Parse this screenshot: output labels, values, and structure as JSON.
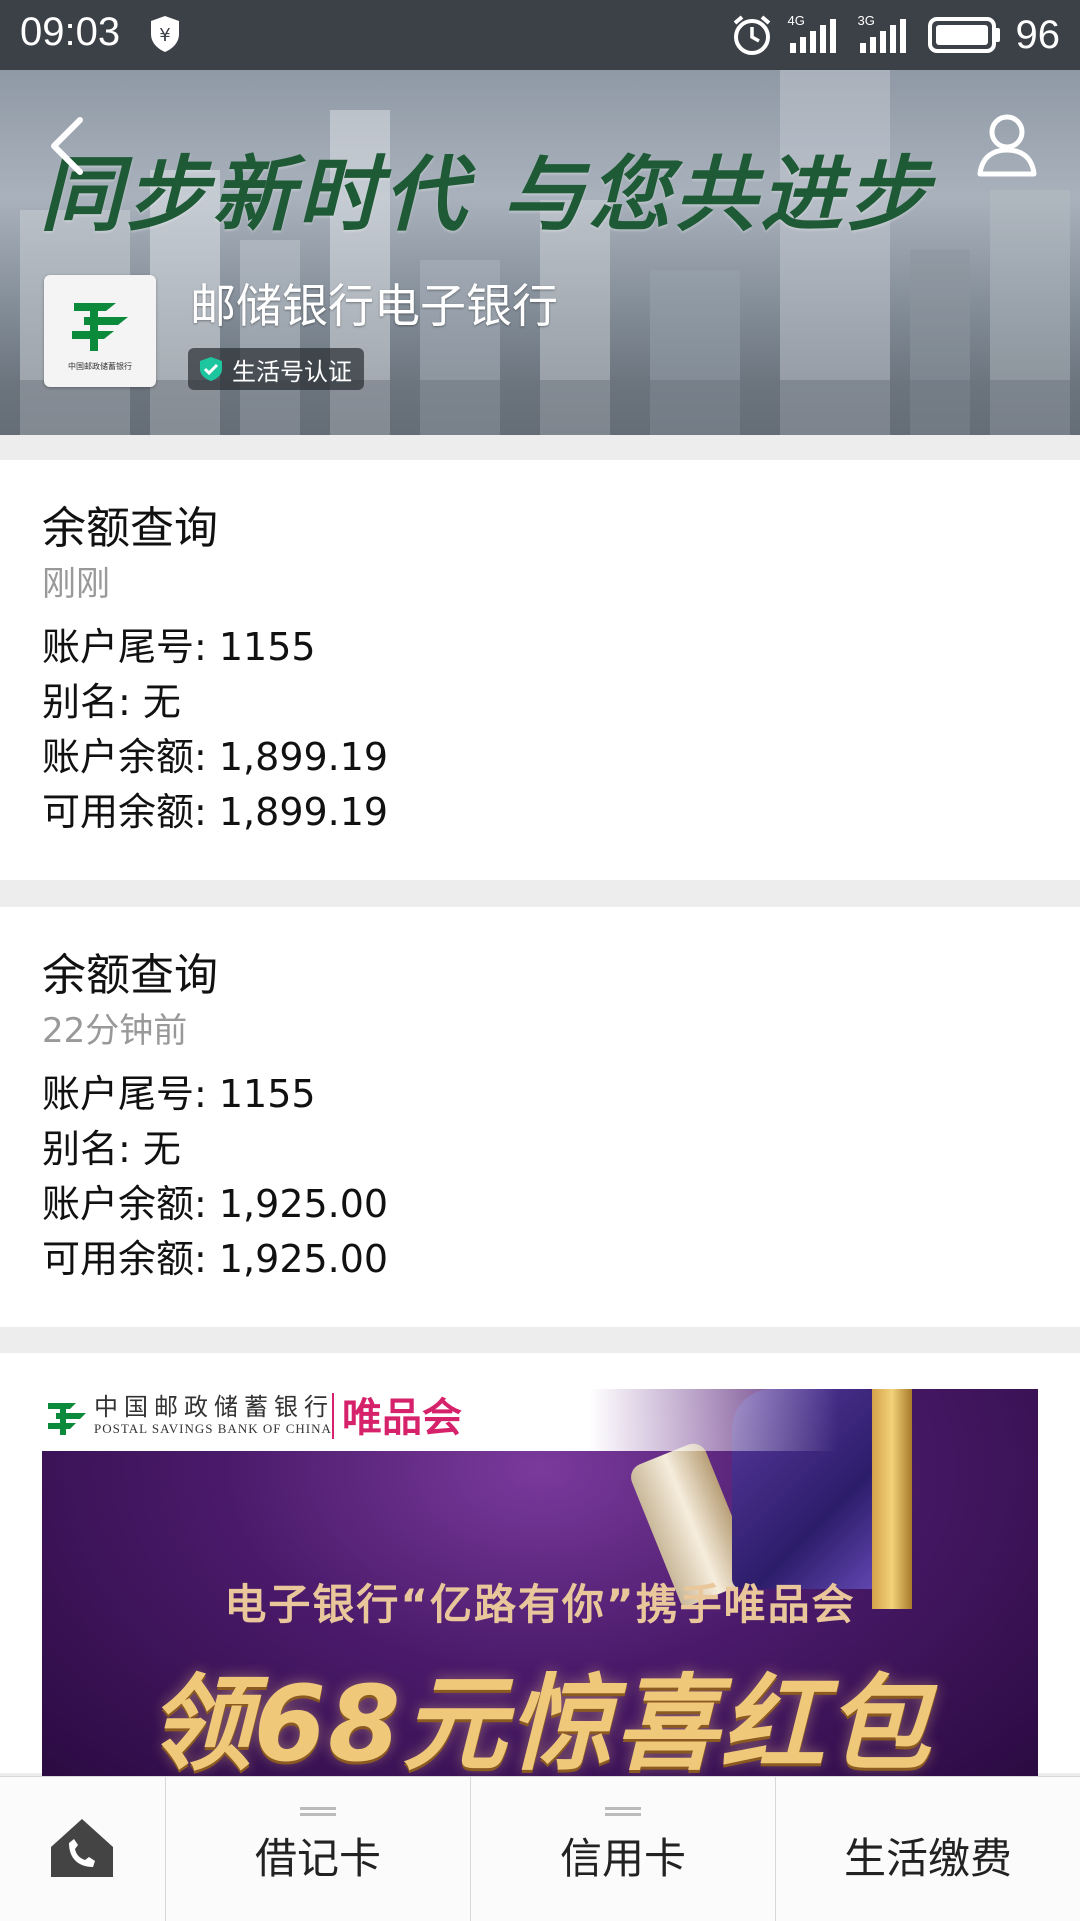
{
  "status_bar": {
    "time": "09:03",
    "battery": "96",
    "net1": "4G",
    "net2": "3G"
  },
  "header": {
    "slogan": "同步新时代 与您共进步",
    "account_name": "邮储银行电子银行",
    "verify_label": "生活号认证",
    "logo_text": "中国邮政储蓄银行"
  },
  "messages": [
    {
      "title": "余额查询",
      "time": "刚刚",
      "lines": [
        "账户尾号: 1155",
        "别名: 无",
        "账户余额: 1,899.19",
        "可用余额: 1,899.19"
      ]
    },
    {
      "title": "余额查询",
      "time": "22分钟前",
      "lines": [
        "账户尾号: 1155",
        "别名: 无",
        "账户余额: 1,925.00",
        "可用余额: 1,925.00"
      ]
    }
  ],
  "promo": {
    "bank_cn": "中国邮政储蓄银行",
    "bank_en": "POSTAL SAVINGS BANK OF CHINA",
    "partner": "唯品会",
    "subtitle": "电子银行“亿路有你”携手唯品会",
    "headline": "领68元惊喜红包"
  },
  "menu": {
    "items": [
      "借记卡",
      "信用卡",
      "生活缴费"
    ]
  },
  "colors": {
    "status_bar": "#3c4047",
    "slogan_green": "#1f5a36",
    "promo_gold": "#f0c87a",
    "promo_purple": "#4a1a6a",
    "vip_pink": "#d6226b"
  }
}
